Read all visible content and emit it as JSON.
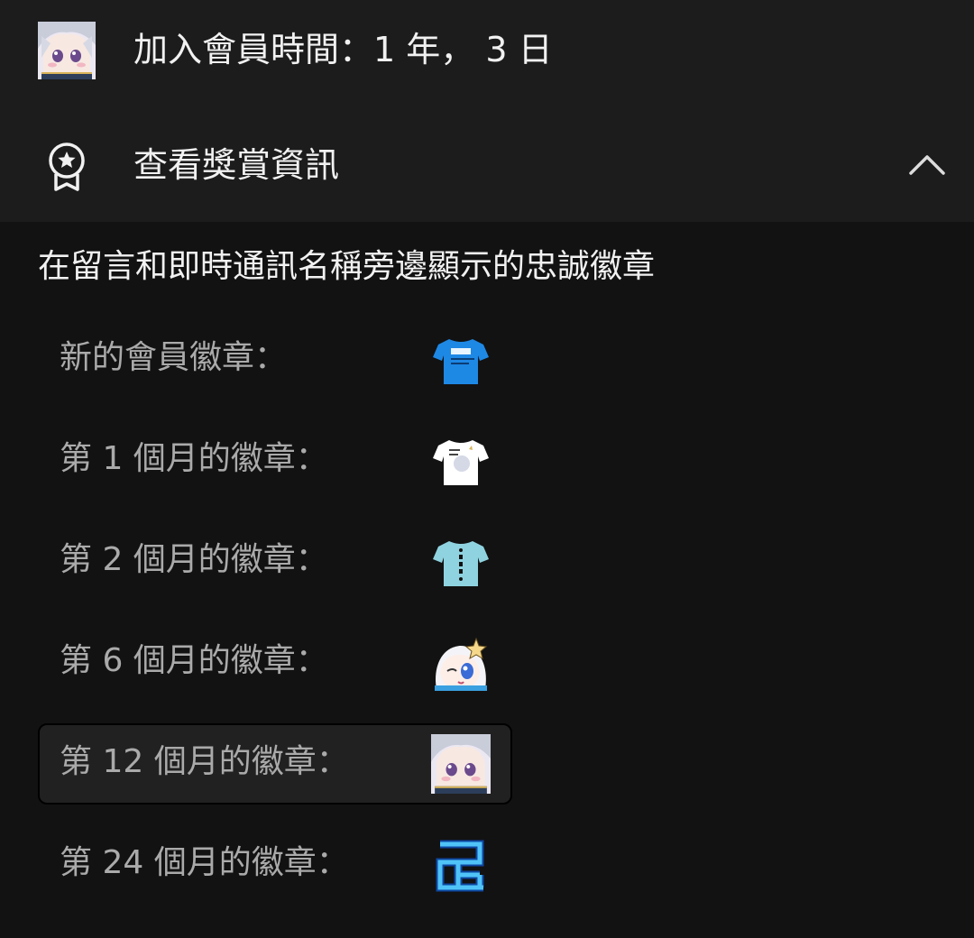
{
  "membership": {
    "duration_text": "加入會員時間：1 年， 3 日",
    "avatar_icon": "member-avatar"
  },
  "rewards": {
    "label": "查看獎賞資訊",
    "icon": "award-icon",
    "toggle_icon": "chevron-up-icon"
  },
  "badges_section": {
    "title": "在留言和即時通訊名稱旁邊顯示的忠誠徽章",
    "items": [
      {
        "label": "新的會員徽章：",
        "icon": "blue-tshirt-badge"
      },
      {
        "label": "第 1 個月的徽章：",
        "icon": "white-tshirt-badge"
      },
      {
        "label": "第 2 個月的徽章：",
        "icon": "lightblue-tshirt-badge"
      },
      {
        "label": "第 6 個月的徽章：",
        "icon": "chibi-character-badge"
      },
      {
        "label": "第 12 個月的徽章：",
        "icon": "character-portrait-badge",
        "selected": true
      },
      {
        "label": "第 24 個月的徽章：",
        "icon": "kanji-badge"
      }
    ]
  },
  "colors": {
    "background": "#121212",
    "header_background": "#1c1c1c",
    "text_primary": "#f1f1f1",
    "text_secondary": "#aaaaaa",
    "selected_row": "#212121",
    "badge_blue": "#1e88e5",
    "badge_lightblue": "#8fd3e0"
  }
}
